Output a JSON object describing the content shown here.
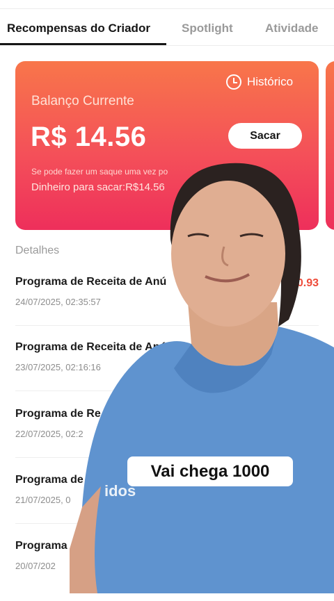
{
  "tabs": [
    {
      "label": "Recompensas do Criador",
      "active": true
    },
    {
      "label": "Spotlight",
      "active": false
    },
    {
      "label": "Atividade",
      "active": false
    }
  ],
  "card": {
    "history_label": "Histórico",
    "balance_label": "Balanço Currente",
    "balance_value": "R$ 14.56",
    "withdraw_label": "Sacar",
    "note": "Se pode fazer um saque uma vez po",
    "available_text": "Dinheiro para sacar:R$14.56"
  },
  "details": {
    "title": "Detalhes",
    "rows": [
      {
        "title": "Programa de Receita de Anú",
        "date": "24/07/2025, 02:35:57",
        "amount": "R$0.93"
      },
      {
        "title": "Programa de Receita de Anú",
        "date": "23/07/2025, 02:16:16",
        "amount": ""
      },
      {
        "title": "Programa de Re",
        "date": "22/07/2025, 02:2",
        "amount": ""
      },
      {
        "title": "Programa de",
        "date": "21/07/2025, 0",
        "amount": ""
      },
      {
        "title": "Programa",
        "date": "20/07/202",
        "amount": ""
      }
    ]
  },
  "overlay": {
    "caption": "Vai chega 1000",
    "shirt_text": "idos"
  },
  "colors": {
    "card_top": "#f8764a",
    "card_bottom": "#ee2f5b",
    "shirt": "#5f93cf",
    "amount": "#ee4b39"
  }
}
